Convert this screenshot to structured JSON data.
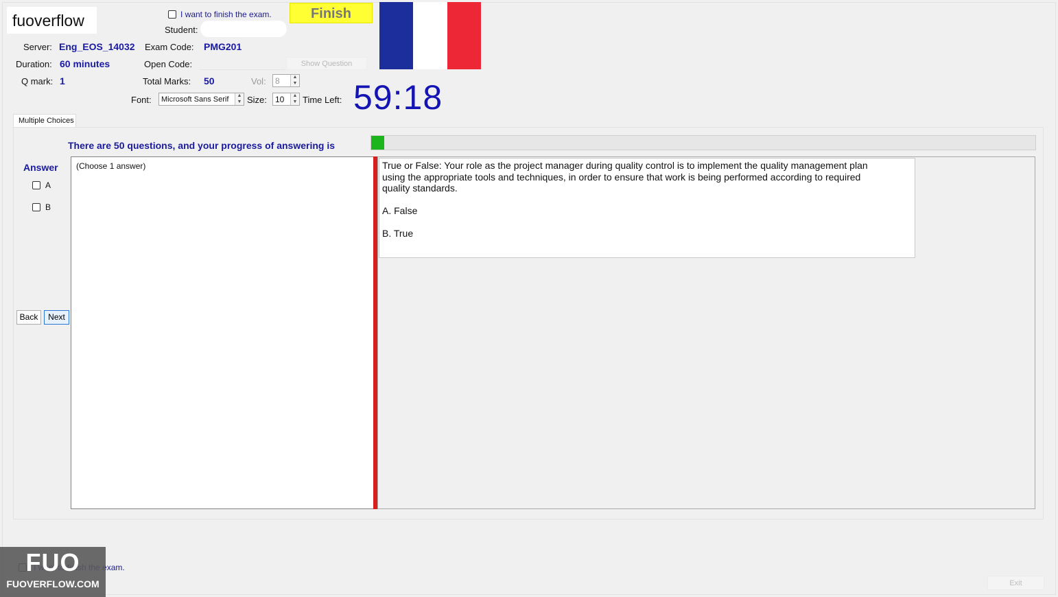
{
  "brand": "fuoverflow",
  "header": {
    "finish_checkbox_label": "I want to finish the exam.",
    "finish_button": "Finish",
    "student_label": "Student:",
    "server_label": "Server:",
    "server_value": "Eng_EOS_14032",
    "exam_code_label": "Exam Code:",
    "exam_code_value": "PMG201",
    "duration_label": "Duration:",
    "duration_value": "60 minutes",
    "open_code_label": "Open Code:",
    "show_question_button": "Show Question",
    "qmark_label": "Q mark:",
    "qmark_value": "1",
    "total_marks_label": "Total Marks:",
    "total_marks_value": "50",
    "vol_label": "Vol:",
    "vol_value": "8",
    "font_label": "Font:",
    "font_value": "Microsoft Sans Serif",
    "size_label": "Size:",
    "size_value": "10",
    "time_left_label": "Time Left:",
    "time_left_value": "59:18"
  },
  "flag_colors": [
    "#1c2e9c",
    "#ffffff",
    "#ee2737"
  ],
  "tab_label": "Multiple Choices",
  "progress": {
    "text": "There are 50 questions, and your progress of answering is",
    "fraction": 0.02,
    "color": "#1cb61c"
  },
  "answer": {
    "title": "Answer",
    "options": [
      "A",
      "B"
    ],
    "hint": "(Choose 1 answer)"
  },
  "nav": {
    "back": "Back",
    "next": "Next"
  },
  "question": {
    "text": "True or False: Your role as the project manager during quality control is to implement the quality management plan using the appropriate tools and techniques, in order to ensure that work is being performed according to required quality standards.",
    "option_a": "A.  False",
    "option_b": "B.  True"
  },
  "footer": {
    "finish_checkbox_label": "I want to finish the exam.",
    "exit_button": "Exit"
  },
  "watermark": {
    "logo": "FUO",
    "site": "FUOVERFLOW.COM"
  }
}
